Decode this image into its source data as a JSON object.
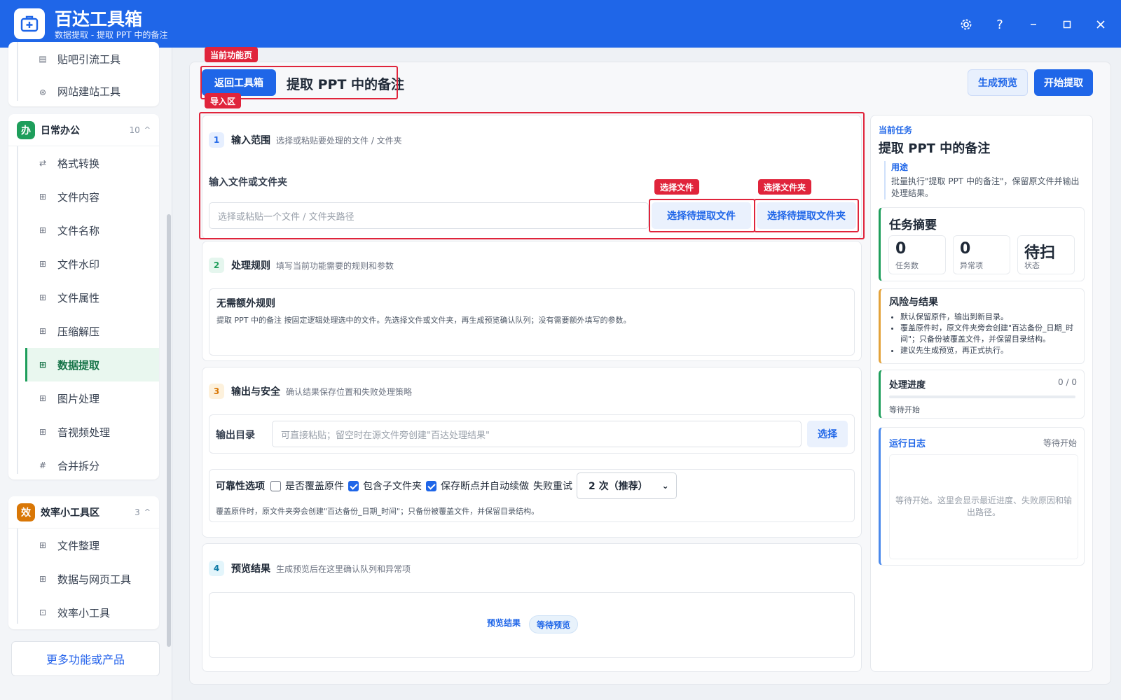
{
  "app": {
    "name": "百达工具箱",
    "subtitle": "数据提取 - 提取 PPT 中的备注"
  },
  "sidebar": {
    "top_items": [
      {
        "label": "贴吧引流工具",
        "icon": "doc-icon"
      },
      {
        "label": "网站建站工具",
        "icon": "globe-icon"
      }
    ],
    "groups": [
      {
        "badge": "办",
        "title": "日常办公",
        "count": "10",
        "color": "#1e9e5b",
        "items": [
          {
            "label": "格式转换",
            "icon": "swap-icon"
          },
          {
            "label": "文件内容",
            "icon": "grid-icon"
          },
          {
            "label": "文件名称",
            "icon": "grid-icon"
          },
          {
            "label": "文件水印",
            "icon": "grid-icon"
          },
          {
            "label": "文件属性",
            "icon": "grid-icon"
          },
          {
            "label": "压缩解压",
            "icon": "grid-icon"
          },
          {
            "label": "数据提取",
            "icon": "grid-icon",
            "active": true
          },
          {
            "label": "图片处理",
            "icon": "grid-icon"
          },
          {
            "label": "音视频处理",
            "icon": "grid-icon"
          },
          {
            "label": "合并拆分",
            "icon": "hash-icon"
          }
        ]
      },
      {
        "badge": "效",
        "title": "效率小工具区",
        "count": "3",
        "color": "#d97706",
        "items": [
          {
            "label": "文件整理",
            "icon": "grid-icon"
          },
          {
            "label": "数据与网页工具",
            "icon": "grid-icon"
          },
          {
            "label": "效率小工具",
            "icon": "box-icon"
          }
        ]
      }
    ],
    "more": "更多功能或产品"
  },
  "header": {
    "back": "返回工具箱",
    "title": "提取 PPT 中的备注",
    "preview": "生成预览",
    "start": "开始提取"
  },
  "annotations": {
    "current_page": "当前功能页",
    "import_area": "导入区",
    "select_file": "选择文件",
    "select_folder": "选择文件夹"
  },
  "sections": {
    "input": {
      "num": "1",
      "title": "输入范围",
      "desc": "选择或粘贴要处理的文件 / 文件夹",
      "label": "输入文件或文件夹",
      "placeholder": "选择或粘贴一个文件 / 文件夹路径",
      "btn_file": "选择待提取文件",
      "btn_folder": "选择待提取文件夹"
    },
    "rules": {
      "num": "2",
      "title": "处理规则",
      "desc": "填写当前功能需要的规则和参数",
      "box_title": "无需额外规则",
      "box_text": "提取 PPT 中的备注 按固定逻辑处理选中的文件。先选择文件或文件夹，再生成预览确认队列；没有需要额外填写的参数。"
    },
    "output": {
      "num": "3",
      "title": "输出与安全",
      "desc": "确认结果保存位置和失败处理策略",
      "dir_label": "输出目录",
      "dir_placeholder": "可直接粘贴；留空时在源文件旁创建\"百达处理结果\"",
      "dir_btn": "选择",
      "reliability": "可靠性选项",
      "overwrite": "是否覆盖原件",
      "overwrite_checked": false,
      "subfolders": "包含子文件夹",
      "subfolders_checked": true,
      "resume": "保存断点并自动续做",
      "resume_checked": true,
      "retry_label": "失败重试",
      "retry_value": "2 次（推荐）",
      "note": "覆盖原件时，原文件夹旁会创建\"百达备份_日期_时间\"；只备份被覆盖文件，并保留目录结构。"
    },
    "preview": {
      "num": "4",
      "title": "预览结果",
      "desc": "生成预览后在这里确认队列和异常项",
      "label": "预览结果",
      "status": "等待预览"
    }
  },
  "right": {
    "kicker": "当前任务",
    "title": "提取 PPT 中的备注",
    "usage_label": "用途",
    "usage_text": "批量执行\"提取 PPT 中的备注\"，保留原文件并输出处理结果。",
    "summary_title": "任务摘要",
    "stats": [
      {
        "v": "0",
        "k": "任务数"
      },
      {
        "v": "0",
        "k": "异常项"
      },
      {
        "v": "待扫",
        "k": "状态"
      }
    ],
    "risk_title": "风险与结果",
    "risk_items": [
      "默认保留原件，输出到新目录。",
      "覆盖原件时，原文件夹旁会创建\"百达备份_日期_时间\"；只备份被覆盖文件，并保留目录结构。",
      "建议先生成预览，再正式执行。"
    ],
    "progress_title": "处理进度",
    "progress_count": "0 / 0",
    "progress_fraction": 0,
    "progress_status": "等待开始",
    "log_title": "运行日志",
    "log_status": "等待开始",
    "log_text": "等待开始。这里会显示最近进度、失败原因和输出路径。"
  }
}
